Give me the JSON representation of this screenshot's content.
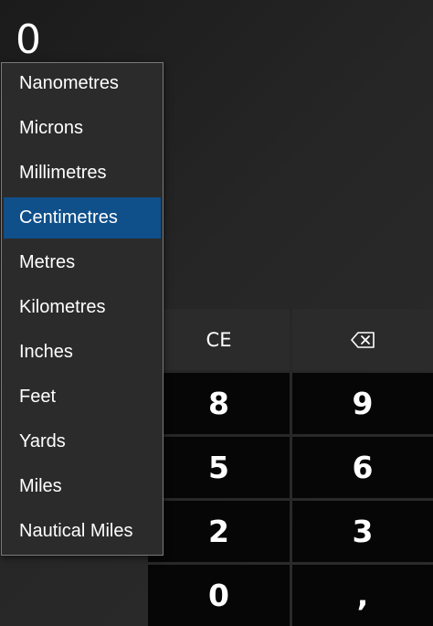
{
  "display": {
    "value": "0"
  },
  "unit_dropdown": {
    "selected": "Centimetres",
    "options": [
      "Nanometres",
      "Microns",
      "Millimetres",
      "Centimetres",
      "Metres",
      "Kilometres",
      "Inches",
      "Feet",
      "Yards",
      "Miles",
      "Nautical Miles"
    ]
  },
  "keypad": {
    "clear_entry": "CE",
    "backspace_icon": "backspace-icon",
    "keys": {
      "eight": "8",
      "nine": "9",
      "five": "5",
      "six": "6",
      "two": "2",
      "three": "3",
      "zero": "0",
      "decimal": ","
    }
  },
  "colors": {
    "selected_item": "#0f4f8a",
    "number_key": "#060606",
    "function_key": "#2b2b2b",
    "dropdown_bg": "#2b2b2b"
  }
}
